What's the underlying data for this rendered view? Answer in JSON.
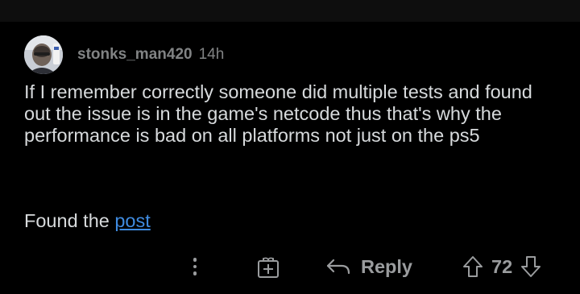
{
  "comment": {
    "username": "stonks_man420",
    "timestamp": "14h",
    "body": "If I remember correctly someone did multiple tests and found out the issue is in the game's netcode thus that's why the performance is bad on all platforms not just on the ps5",
    "found_prefix": "Found the ",
    "link_text": "post"
  },
  "actions": {
    "more_icon": "more-vertical-icon",
    "award_icon": "award-icon",
    "reply_icon": "reply-arrow-icon",
    "reply_label": "Reply",
    "upvote_icon": "upvote-arrow-icon",
    "vote_count": "72",
    "downvote_icon": "downvote-arrow-icon"
  },
  "colors": {
    "background": "#000000",
    "text": "#d7dadc",
    "meta": "#818384",
    "link": "#3f8be0",
    "icon": "#9a9c9e"
  }
}
